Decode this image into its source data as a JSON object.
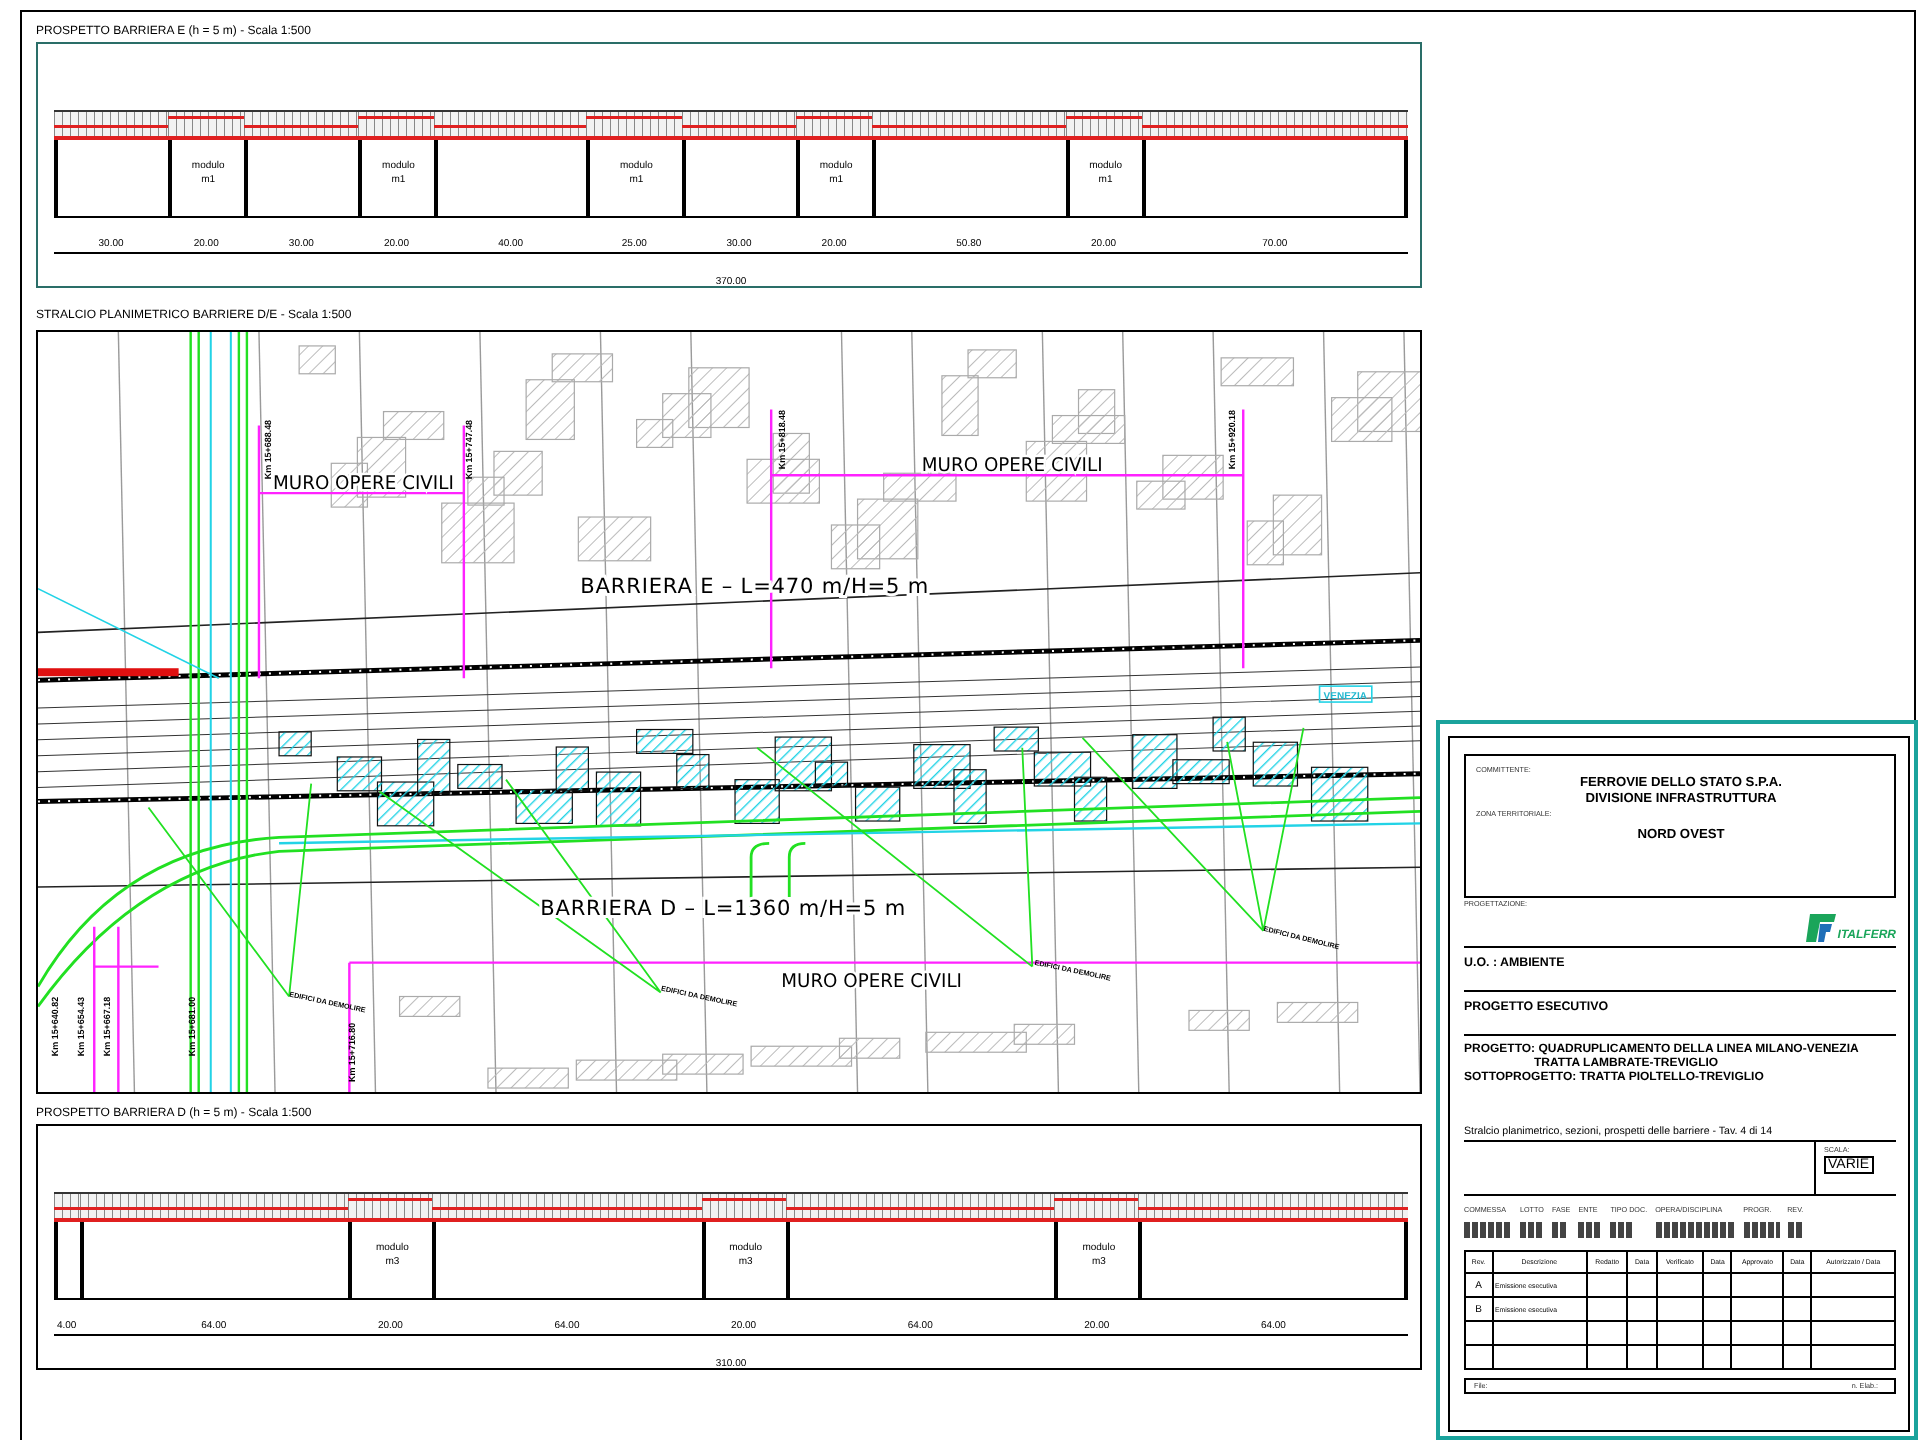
{
  "elevation_e": {
    "title": "PROSPETTO BARRIERA E (h = 5 m) - Scala 1:500",
    "segments": [
      {
        "length": "30.00",
        "kind": "span"
      },
      {
        "length": "20.00",
        "kind": "module",
        "module": "modulo",
        "code": "m1"
      },
      {
        "length": "30.00",
        "kind": "span"
      },
      {
        "length": "20.00",
        "kind": "module",
        "module": "modulo",
        "code": "m1"
      },
      {
        "length": "40.00",
        "kind": "span"
      },
      {
        "length": "25.00",
        "kind": "module",
        "module": "modulo",
        "code": "m1"
      },
      {
        "length": "30.00",
        "kind": "span"
      },
      {
        "length": "20.00",
        "kind": "module",
        "module": "modulo",
        "code": "m1"
      },
      {
        "length": "50.80",
        "kind": "span"
      },
      {
        "length": "20.00",
        "kind": "module",
        "module": "modulo",
        "code": "m1"
      },
      {
        "length": "70.00",
        "kind": "span"
      }
    ],
    "total": "370.00"
  },
  "plan": {
    "title": "STRALCIO PLANIMETRICO BARRIERE D/E - Scala 1:500",
    "wall_labels": [
      "MURO OPERE CIVILI",
      "MURO OPERE CIVILI",
      "MURO OPERE CIVILI"
    ],
    "barrier_labels": [
      "BARRIERA E – L=470 m/H=5 m",
      "BARRIERA D – L=1360 m/H=5 m"
    ],
    "km_labels_top": [
      "Km 15+688.48",
      "Km 15+747.48",
      "Km 15+818.48",
      "Km 15+920.18"
    ],
    "km_labels_bottom": [
      "Km 15+640.82",
      "Km 15+654.43",
      "Km 15+667.18",
      "Km 15+681.00",
      "Km 15+716.80"
    ],
    "demolition_labels": [
      "EDIFICI DA DEMOLIRE",
      "EDIFICI DA DEMOLIRE",
      "EDIFICI DA DEMOLIRE",
      "EDIFICI DA DEMOLIRE"
    ],
    "direction_label": "VENEZIA"
  },
  "elevation_d": {
    "title": "PROSPETTO BARRIERA D (h = 5 m) - Scala 1:500",
    "segments": [
      {
        "length": "4.00",
        "kind": "span"
      },
      {
        "length": "64.00",
        "kind": "span"
      },
      {
        "length": "20.00",
        "kind": "module",
        "module": "modulo",
        "code": "m3"
      },
      {
        "length": "64.00",
        "kind": "span"
      },
      {
        "length": "20.00",
        "kind": "module",
        "module": "modulo",
        "code": "m3"
      },
      {
        "length": "64.00",
        "kind": "span"
      },
      {
        "length": "20.00",
        "kind": "module",
        "module": "modulo",
        "code": "m3"
      },
      {
        "length": "64.00",
        "kind": "span"
      }
    ],
    "total": "310.00"
  },
  "title_block": {
    "client_label": "COMMITTENTE:",
    "client": [
      "FERROVIE DELLO STATO S.P.A.",
      "DIVISIONE INFRASTRUTTURA"
    ],
    "zone_label": "ZONA TERRITORIALE:",
    "zone": "NORD OVEST",
    "design_label": "PROGETTAZIONE:",
    "designer": "ITALFERR",
    "unit": "U.O. : AMBIENTE",
    "phase": "PROGETTO ESECUTIVO",
    "project": [
      "PROGETTO: QUADRUPLICAMENTO DELLA LINEA MILANO-VENEZIA",
      "TRATTA LAMBRATE-TREVIGLIO",
      "SOTTOPROGETTO: TRATTA PIOLTELLO-TREVIGLIO"
    ],
    "description": "Stralcio planimetrico, sezioni, prospetti delle barriere - Tav. 4 di 14",
    "scale_label": "SCALA:",
    "scale": "VARIE",
    "code_labels": [
      "COMMESSA",
      "LOTTO",
      "FASE",
      "ENTE",
      "TIPO DOC.",
      "OPERA/DISCIPLINA",
      "PROGR.",
      "REV."
    ],
    "revision_columns": [
      "Rev.",
      "Descrizione",
      "Redatto",
      "Data",
      "Verificato",
      "Data",
      "Approvato",
      "Data",
      "Autorizzato / Data"
    ],
    "revisions": [
      {
        "rev": "A",
        "description": "Emissione esecutiva"
      },
      {
        "rev": "B",
        "description": "Emissione esecutiva"
      }
    ],
    "file_label": "File:",
    "sheet_label": "n. Elab.:"
  }
}
